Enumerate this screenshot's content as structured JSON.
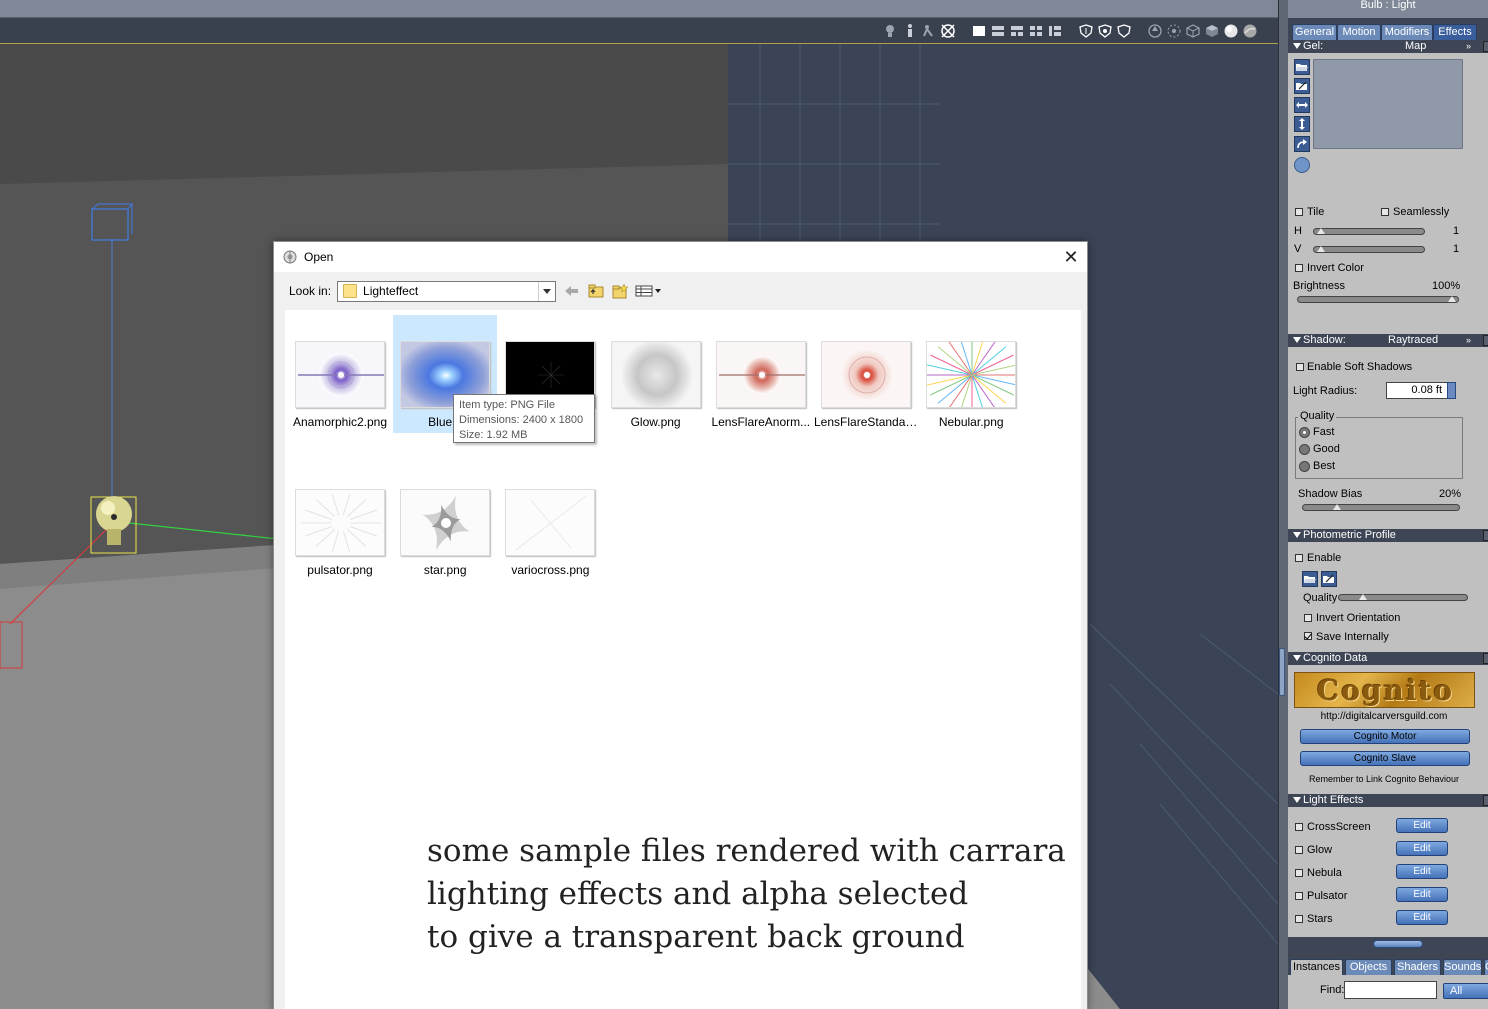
{
  "viewport": {
    "tool_icons": [
      "light-bulb-icon",
      "figure-icon",
      "walk-icon",
      "target-icon",
      "single-view-icon",
      "two-view-horizontal-icon",
      "two-view-vertical-icon",
      "four-view-icon",
      "layout-icon",
      "shield-icon",
      "shield-alt-icon",
      "shield-outline-icon",
      "arrow-up-icon",
      "gizmo-icon",
      "box-wire-icon",
      "box-solid-icon",
      "sphere-shaded-icon",
      "sphere-textured-icon"
    ]
  },
  "dialog": {
    "title": "Open",
    "lookin_label": "Look in:",
    "lookin_value": "Lighteffect",
    "files": [
      {
        "name": "Anamorphic2.png",
        "label": "Anamorphic2.png"
      },
      {
        "name": "BlueFlare.png",
        "label": "BlueFl",
        "selected": true
      },
      {
        "name": "Dark.png",
        "label": ""
      },
      {
        "name": "Glow.png",
        "label": "Glow.png"
      },
      {
        "name": "LensFlareAnormorphic.png",
        "label": "LensFlareAnorm..."
      },
      {
        "name": "LensFlareStandard.png",
        "label": "LensFlareStandar..."
      },
      {
        "name": "Nebular.png",
        "label": "Nebular.png"
      },
      {
        "name": "pulsator.png",
        "label": "pulsator.png"
      },
      {
        "name": "star.png",
        "label": "star.png"
      },
      {
        "name": "variocross.png",
        "label": "variocross.png"
      }
    ],
    "tooltip": {
      "line1": "Item type: PNG File",
      "line2": "Dimensions: 2400 x 1800",
      "line3": "Size: 1.92 MB"
    },
    "caption": {
      "line1": "some sample files rendered with carrara",
      "line2": "lighting effects and alpha selected",
      "line3": "to give a transparent back ground"
    }
  },
  "panel": {
    "title": "Bulb : Light",
    "tabs": [
      "General",
      "Motion",
      "Modifiers",
      "Effects"
    ],
    "active_tab": "Effects",
    "gel": {
      "header": "Gel:",
      "mode": "Map",
      "tile": "Tile",
      "seamlessly": "Seamlessly",
      "h_label": "H",
      "h_value": "1",
      "v_label": "V",
      "v_value": "1",
      "invert_color": "Invert Color",
      "brightness_label": "Brightness",
      "brightness_value": "100%"
    },
    "shadow": {
      "header": "Shadow:",
      "mode": "Raytraced",
      "enable_soft": "Enable Soft Shadows",
      "light_radius_label": "Light Radius:",
      "light_radius_value": "0.08 ft",
      "quality_label": "Quality",
      "quality_options": [
        "Fast",
        "Good",
        "Best"
      ],
      "quality_selected": "Fast",
      "bias_label": "Shadow Bias",
      "bias_value": "20%"
    },
    "photometric": {
      "header": "Photometric Profile",
      "enable": "Enable",
      "quality": "Quality",
      "invert": "Invert Orientation",
      "save": "Save Internally"
    },
    "cognito": {
      "header": "Cognito Data",
      "logo_text": "Cognito",
      "url": "http://digitalcarversguild.com",
      "motor": "Cognito Motor",
      "slave": "Cognito Slave",
      "note": "Remember to Link Cognito Behaviour"
    },
    "light_effects": {
      "header": "Light Effects",
      "items": [
        "CrossScreen",
        "Glow",
        "Nebula",
        "Pulsator",
        "Stars"
      ],
      "edit": "Edit"
    },
    "bottom_tabs": [
      "Instances",
      "Objects",
      "Shaders",
      "Sounds",
      "C"
    ],
    "find_label": "Find:",
    "find_value": "",
    "filter_value": "All"
  }
}
